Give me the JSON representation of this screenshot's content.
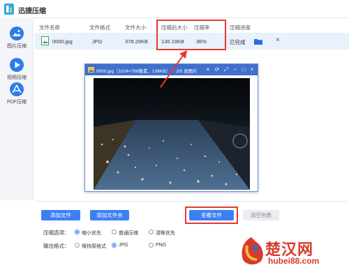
{
  "app": {
    "title": "迅捷压缩"
  },
  "sidebar": {
    "items": [
      {
        "label": "图片压缩"
      },
      {
        "label": "视频压缩"
      },
      {
        "label": "PDF压缩"
      }
    ]
  },
  "table": {
    "headers": {
      "name": "文件名称",
      "format": "文件格式",
      "size": "文件大小",
      "compressed_size": "压缩后大小",
      "ratio": "压缩率",
      "progress": "压缩进度"
    },
    "rows": [
      {
        "name": "0000.jpg",
        "format": "JPG",
        "size": "378.29KB",
        "compressed_size": "136.19KB",
        "ratio": "36%",
        "status": "已完成"
      }
    ]
  },
  "preview": {
    "title": "0000.jpg（1024×768像素，136KB）－ 2/5 张图片"
  },
  "toolbar": {
    "add_file": "添加文件",
    "add_folder": "添加文件夹",
    "view_files": "查看文件",
    "clear_list": "清空列表"
  },
  "options": {
    "compress_label": "压缩选项：",
    "compress_choices": [
      "缩小优先",
      "普通压缩",
      "清晰优先"
    ],
    "compress_selected": "缩小优先",
    "output_label": "输出格式：",
    "output_choices": [
      "保持原格式",
      "JPG",
      "PNG"
    ],
    "output_selected": "JPG"
  },
  "watermark": {
    "main": "楚汉网",
    "sub": "hubei88.com"
  },
  "colors": {
    "accent": "#3d7ff3",
    "highlight": "#e8382e",
    "row_selected": "#e8f1fc",
    "preview_bar": "#3f6fcf"
  }
}
